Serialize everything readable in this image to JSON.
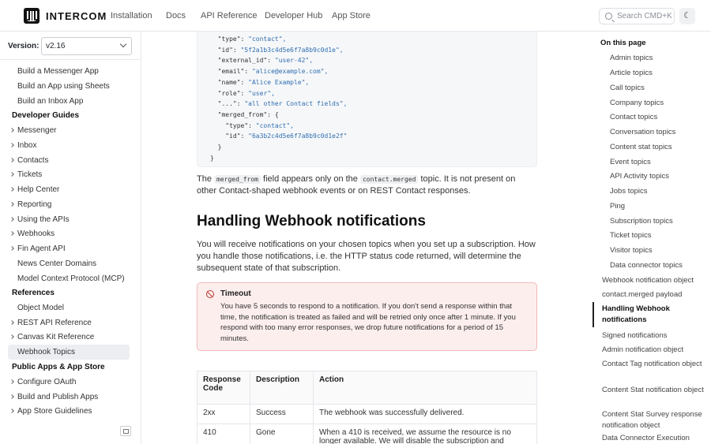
{
  "header": {
    "brand": "INTERCOM",
    "nav": [
      "Installation",
      "Docs",
      "API Reference",
      "Developer Hub",
      "App Store"
    ],
    "search_placeholder": "Search  CMD+K"
  },
  "sidebar": {
    "version_label": "Version:",
    "version_value": "v2.16",
    "items": [
      {
        "label": "Build a Messenger App",
        "type": "leaf"
      },
      {
        "label": "Build an App using Sheets",
        "type": "leaf"
      },
      {
        "label": "Build an Inbox App",
        "type": "leaf"
      },
      {
        "label": "Developer Guides",
        "type": "section"
      },
      {
        "label": "Messenger",
        "type": "expand"
      },
      {
        "label": "Inbox",
        "type": "expand"
      },
      {
        "label": "Contacts",
        "type": "expand"
      },
      {
        "label": "Tickets",
        "type": "expand"
      },
      {
        "label": "Help Center",
        "type": "expand"
      },
      {
        "label": "Reporting",
        "type": "expand"
      },
      {
        "label": "Using the APIs",
        "type": "expand"
      },
      {
        "label": "Webhooks",
        "type": "expand"
      },
      {
        "label": "Fin Agent API",
        "type": "expand"
      },
      {
        "label": "News Center Domains",
        "type": "leaf"
      },
      {
        "label": "Model Context Protocol (MCP)",
        "type": "leaf"
      },
      {
        "label": "References",
        "type": "section"
      },
      {
        "label": "Object Model",
        "type": "leaf"
      },
      {
        "label": "REST API Reference",
        "type": "expand"
      },
      {
        "label": "Canvas Kit Reference",
        "type": "expand"
      },
      {
        "label": "Webhook Topics",
        "type": "active"
      },
      {
        "label": "Public Apps & App Store",
        "type": "section"
      },
      {
        "label": "Configure OAuth",
        "type": "expand"
      },
      {
        "label": "Build and Publish Apps",
        "type": "expand"
      },
      {
        "label": "App Store Guidelines",
        "type": "expand"
      }
    ]
  },
  "code": {
    "lines": [
      {
        "k": "  \"type\": ",
        "v": "\"contact\","
      },
      {
        "k": "  \"id\": ",
        "v": "\"5f2a1b3c4d5e6f7a8b9c0d1e\","
      },
      {
        "k": "  \"external_id\": ",
        "v": "\"user-42\","
      },
      {
        "k": "  \"email\": ",
        "v": "\"alice@example.com\","
      },
      {
        "k": "  \"name\": ",
        "v": "\"Alice Example\","
      },
      {
        "k": "  \"role\": ",
        "v": "\"user\","
      },
      {
        "k": "  \"...\": ",
        "v": "\"all other Contact fields\","
      },
      {
        "k": "  \"merged_from\": {",
        "v": ""
      },
      {
        "k": "    \"type\": ",
        "v": "\"contact\","
      },
      {
        "k": "    \"id\": ",
        "v": "\"6a3b2c4d5e6f7a8b9c0d1e2f\""
      },
      {
        "k": "  }",
        "v": ""
      },
      {
        "k": "}",
        "v": ""
      }
    ]
  },
  "content": {
    "merged_p_1": "The ",
    "merged_code_1": "merged_from",
    "merged_p_2": " field appears only on the ",
    "merged_code_2": "contact.merged",
    "merged_p_3": " topic. It is not present on other Contact-shaped webhook events or on REST Contact responses.",
    "heading": "Handling Webhook notifications",
    "intro": "You will receive notifications on your chosen topics when you set up a subscription. How you handle those notifications, i.e. the HTTP status code returned, will determine the subsequent state of that subscription.",
    "alert_title": "Timeout",
    "alert_body": "You have 5 seconds to respond to a notification. If you don't send a response within that time, the notification is treated as failed and will be retried only once after 1 minute. If you respond with too many error responses, we drop future notifications for a period of 15 minutes.",
    "table": {
      "headers": [
        "Response Code",
        "Description",
        "Action"
      ],
      "rows": [
        [
          "2xx",
          "Success",
          "The webhook was successfully delivered."
        ],
        [
          "410",
          "Gone",
          "When a 410 is received, we assume the resource is no longer available. We will disable the subscription and"
        ]
      ]
    }
  },
  "toc": {
    "title": "On this page",
    "items": [
      {
        "label": "Admin topics",
        "level": 2
      },
      {
        "label": "Article topics",
        "level": 2
      },
      {
        "label": "Call topics",
        "level": 2
      },
      {
        "label": "Company topics",
        "level": 2
      },
      {
        "label": "Contact topics",
        "level": 2
      },
      {
        "label": "Conversation topics",
        "level": 2
      },
      {
        "label": "Content stat topics",
        "level": 2
      },
      {
        "label": "Event topics",
        "level": 2
      },
      {
        "label": "API Activity topics",
        "level": 2
      },
      {
        "label": "Jobs topics",
        "level": 2
      },
      {
        "label": "Ping",
        "level": 2
      },
      {
        "label": "Subscription topics",
        "level": 2
      },
      {
        "label": "Ticket topics",
        "level": 2
      },
      {
        "label": "Visitor topics",
        "level": 2
      },
      {
        "label": "Data connector topics",
        "level": 2
      },
      {
        "label": "Webhook notification object",
        "level": 1
      },
      {
        "label": "contact.merged payload",
        "level": 1
      },
      {
        "label": "Handling Webhook notifications",
        "level": 1,
        "active": true
      },
      {
        "label": "Signed notifications",
        "level": 1
      },
      {
        "label": "Admin notification object",
        "level": 1
      },
      {
        "label": "Contact Tag notification object",
        "level": 1
      },
      {
        "label": "Content Stat notification object",
        "level": 1
      },
      {
        "label": "Content Stat Survey response notification object",
        "level": 1
      },
      {
        "label": "Data Connector Execution",
        "level": 1
      }
    ]
  },
  "colors": {
    "accent": "#111111",
    "alert_bg": "#fdeeee",
    "alert_border": "#f2b8b8",
    "code_string": "#2f6fb0"
  }
}
